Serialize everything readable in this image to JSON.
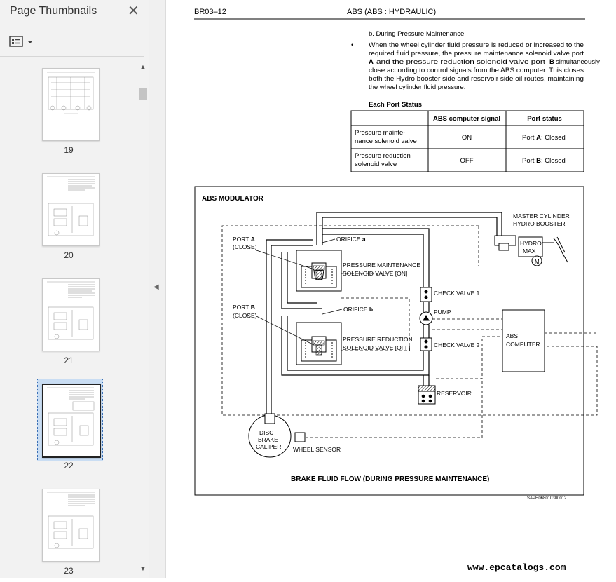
{
  "sidebar": {
    "title": "Page Thumbnails",
    "close_glyph": "✕",
    "options_icon": "thumbnail-options-icon",
    "thumbnails": [
      {
        "label": "19",
        "selected": false
      },
      {
        "label": "20",
        "selected": false
      },
      {
        "label": "21",
        "selected": false
      },
      {
        "label": "22",
        "selected": true
      },
      {
        "label": "23",
        "selected": false
      }
    ]
  },
  "document": {
    "header_left": "BR03–12",
    "header_center": "ABS (ABS : HYDRAULIC)",
    "section": "b.   During Pressure Maintenance",
    "bullet": "•",
    "para": [
      "When the wheel cylinder fluid pressure is reduced or increased to the",
      "required fluid pressure, the pressure maintenance solenoid valve port",
      "and the pressure reduction solenoid valve port",
      "simultaneously",
      "close according to control signals from the ABS computer. This closes",
      "both the Hydro booster side and reservoir side oil routes, maintaining",
      "the wheel cylinder fluid pressure."
    ],
    "port_a": "A",
    "port_b": "B",
    "table": {
      "title": "Each Port Status",
      "headers": [
        "",
        "ABS computer signal",
        "Port status"
      ],
      "rows": [
        {
          "name1": "Pressure mainte-",
          "name2": "nance solenoid valve",
          "signal": "ON",
          "status_prefix": "Port ",
          "status_port": "A",
          "status_suffix": ": Closed"
        },
        {
          "name1": "Pressure reduction",
          "name2": "solenoid valve",
          "signal": "OFF",
          "status_prefix": "Port ",
          "status_port": "B",
          "status_suffix": ": Closed"
        }
      ]
    },
    "diagram": {
      "title": "ABS MODULATOR",
      "master1": "MASTER CYLINDER",
      "master2": "HYDRO BOOSTER",
      "hydro1": "HYDRO",
      "hydro2": "MAX",
      "motor": "M",
      "port_a_label": "PORT",
      "port_a_letter": "A",
      "port_a_state": "(CLOSE)",
      "port_b_label": "PORT",
      "port_b_letter": "B",
      "port_b_state": "(CLOSE)",
      "orifice_a": "ORIFICE",
      "orifice_a_letter": "a",
      "orifice_b": "ORIFICE",
      "orifice_b_letter": "b",
      "pm_valve1": "PRESSURE MAINTENANCE",
      "pm_valve2": "SOLENOID VALVE [ON]",
      "pr_valve1": "PRESSURE REDUCTION",
      "pr_valve2": "SOLENOID VALVE [OFF]",
      "check1": "CHECK VALVE 1",
      "pump": "PUMP",
      "check2": "CHECK VALVE 2",
      "abs1": "ABS",
      "abs2": "COMPUTER",
      "reservoir": "RESERVOIR",
      "caliper1": "DISC",
      "caliper2": "BRAKE",
      "caliper3": "CALIPER",
      "wheel_sensor": "WHEEL SENSOR",
      "caption": "BRAKE FLUID FLOW (DURING PRESSURE MAINTENANCE)",
      "code": "SAPH068010300012"
    },
    "watermark": "www.epcatalogs.com"
  }
}
